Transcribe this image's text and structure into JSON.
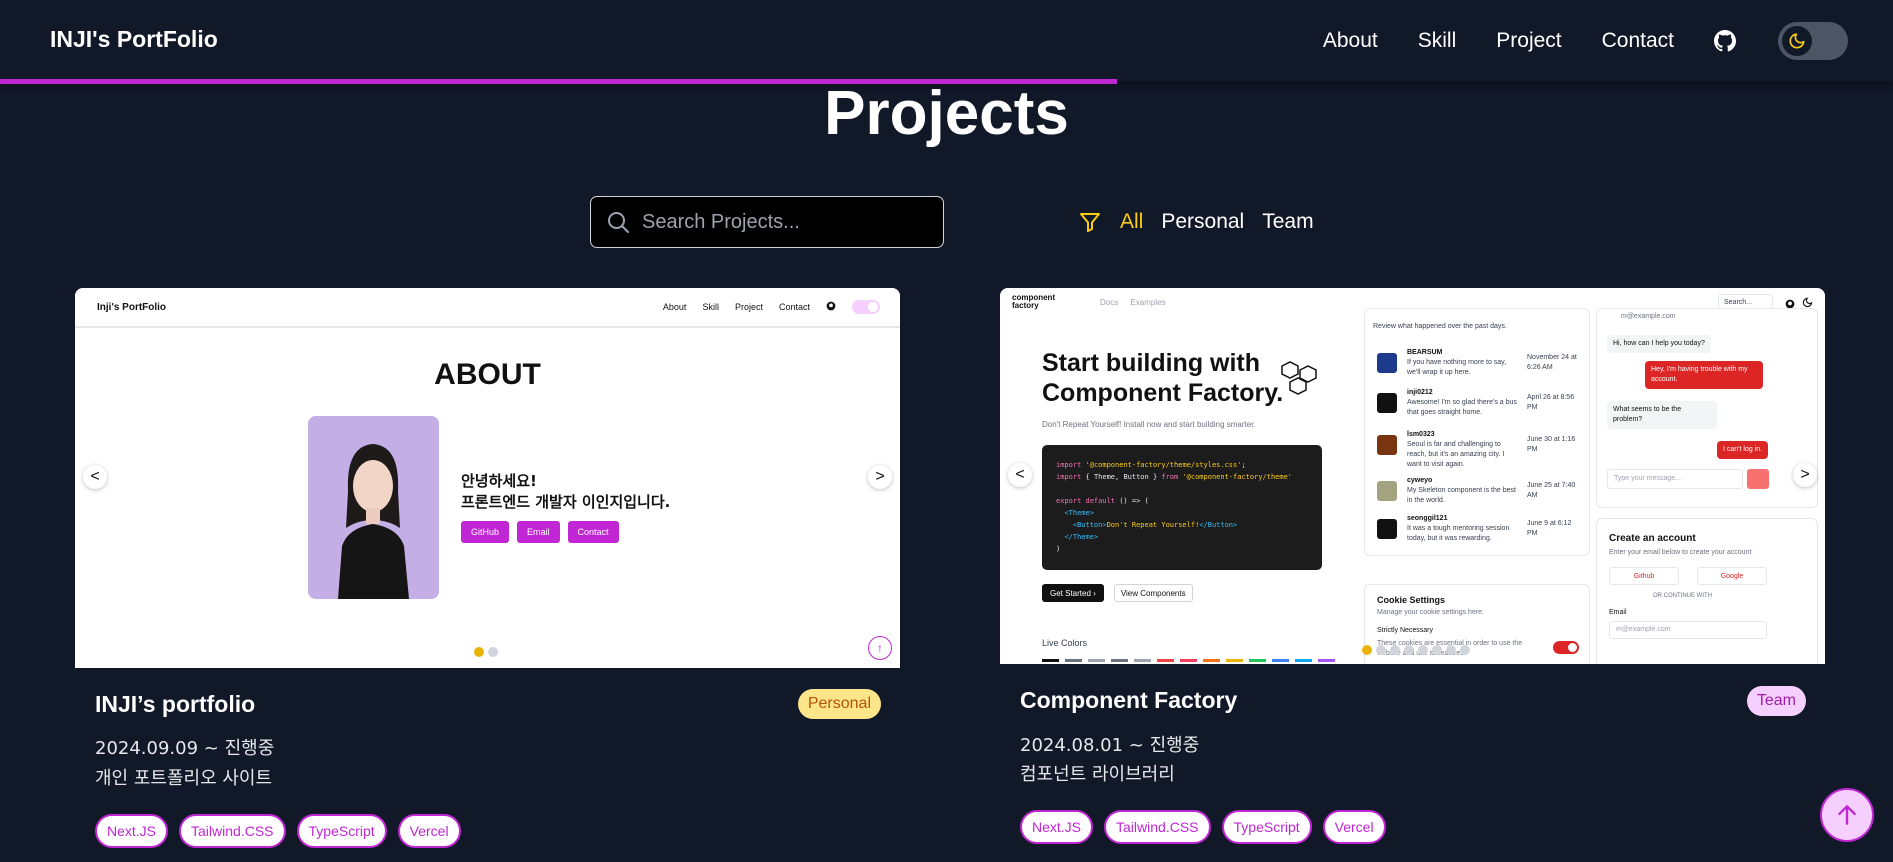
{
  "header": {
    "brand": "INJI's PortFolio",
    "nav": [
      "About",
      "Skill",
      "Project",
      "Contact"
    ],
    "scroll_progress": 0.59
  },
  "page": {
    "title": "Projects",
    "search_placeholder": "Search Projects...",
    "filters": [
      "All",
      "Personal",
      "Team"
    ],
    "active_filter": "All"
  },
  "colors": {
    "background": "#111827",
    "accent": "#c026d3",
    "active_filter": "#facc15",
    "personal_badge": "#fde68a",
    "team_badge": "#f5d0fe"
  },
  "projects": [
    {
      "title": "INJI’s portfolio",
      "badge": "Personal",
      "date": "2024.09.09 ~ 진행중",
      "desc": "개인 포트폴리오 사이트",
      "tags": [
        "Next.JS",
        "Tailwind.CSS",
        "TypeScript",
        "Vercel"
      ],
      "preview": {
        "brand": "Inji's PortFolio",
        "nav": [
          "About",
          "Skill",
          "Project",
          "Contact"
        ],
        "heading": "ABOUT",
        "greeting": "안녕하세요!",
        "intro": "프론트엔드 개발자 이인지입니다.",
        "buttons": [
          "GitHub",
          "Email",
          "Contact"
        ],
        "prev": "<",
        "next": ">"
      }
    },
    {
      "title": "Component Factory",
      "badge": "Team",
      "date": "2024.08.01 ~ 진행중",
      "desc": "컴포넌트 라이브러리",
      "tags": [
        "Next.JS",
        "Tailwind.CSS",
        "TypeScript",
        "Vercel"
      ],
      "preview": {
        "logo_line1": "component",
        "logo_line2": "factory",
        "nav": [
          "Docs",
          "Examples"
        ],
        "search": "Search...",
        "hero_line1": "Start building with",
        "hero_line2": "Component Factory.",
        "sub": "Don't Repeat Yourself! Install now and start building smarter.",
        "get_started": "Get Started",
        "view_components": "View Components",
        "live_colors": "Live Colors",
        "review_caption": "Review what happened over the past days.",
        "reviews": [
          {
            "name": "BEARSUM",
            "text": "If you have nothing more to say, we'll wrap it up here.",
            "date": "November 24 at 6:26 AM"
          },
          {
            "name": "inji0212",
            "text": "Awesome! I'm so glad there's a bus that goes straight home.",
            "date": "April 26 at 8:56 PM"
          },
          {
            "name": "lsm0323",
            "text": "Seoul is far and challenging to reach, but it's an amazing city. I want to visit again.",
            "date": "June 30 at 1:16 PM"
          },
          {
            "name": "cyweyo",
            "text": "My Skeleton component is the best in the world.",
            "date": "June 25 at 7:40 AM"
          },
          {
            "name": "seonggil121",
            "text": "It was a tough mentoring session today, but it was rewarding.",
            "date": "June 9 at 6:12 PM"
          }
        ],
        "cookie_title": "Cookie Settings",
        "cookie_sub": "Manage your cookie settings here.",
        "cookie_item": "Strictly Necessary",
        "cookie_text": "These cookies are essential in order to use the website and use its features.",
        "chat_email": "m@example.com",
        "chat": [
          {
            "dir": "in",
            "text": "Hi, how can I help you today?"
          },
          {
            "dir": "out",
            "text": "Hey, I'm having trouble with my account."
          },
          {
            "dir": "in",
            "text": "What seems to be the problem?"
          },
          {
            "dir": "out",
            "text": "I can't log in."
          }
        ],
        "chat_placeholder": "Type your message...",
        "account_title": "Create an account",
        "account_sub": "Enter your email below to create your account",
        "oauth": [
          "Github",
          "Google"
        ],
        "or": "OR CONTINUE WITH",
        "email_label": "Email",
        "email_placeholder": "m@example.com",
        "prev": "<",
        "next": ">"
      }
    }
  ]
}
